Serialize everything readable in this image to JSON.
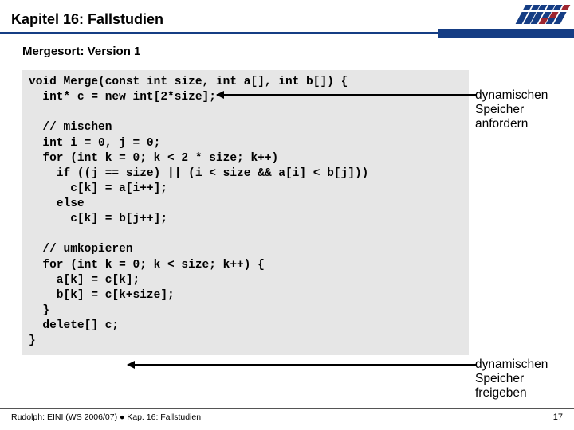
{
  "header": {
    "chapter_title": "Kapitel 16: Fallstudien"
  },
  "subhead": "Mergesort: Version 1",
  "code": "void Merge(const int size, int a[], int b[]) {\n  int* c = new int[2*size];\n\n  // mischen\n  int i = 0, j = 0;\n  for (int k = 0; k < 2 * size; k++)\n    if ((j == size) || (i < size && a[i] < b[j]))\n      c[k] = a[i++];\n    else\n      c[k] = b[j++];\n\n  // umkopieren\n  for (int k = 0; k < size; k++) {\n    a[k] = c[k];\n    b[k] = c[k+size];\n  }\n  delete[] c;\n}",
  "annotations": {
    "alloc": "dynamischen Speicher anfordern",
    "free": "dynamischen Speicher freigeben"
  },
  "footer": {
    "text": "Rudolph: EINI (WS 2006/07) ● Kap. 16: Fallstudien",
    "page": "17"
  }
}
